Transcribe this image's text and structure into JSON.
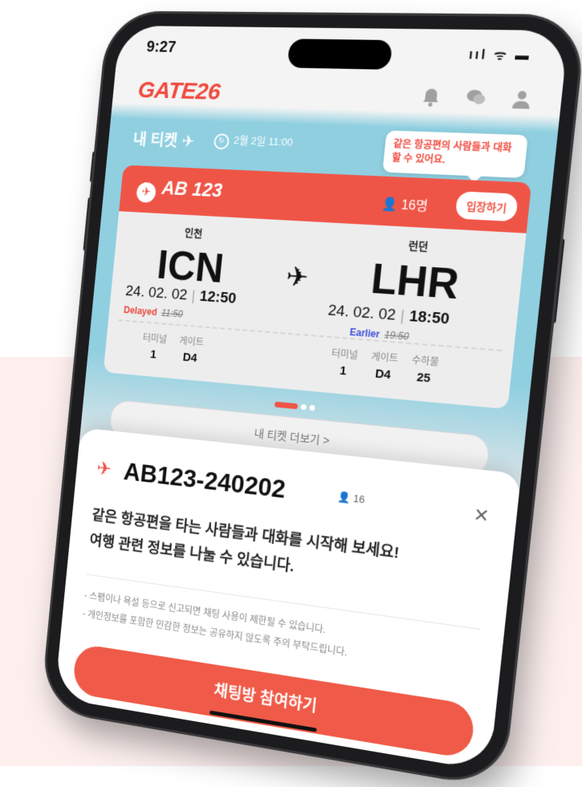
{
  "status_bar": {
    "time": "9:27",
    "icons": "ııl ᯤ ▬"
  },
  "header": {
    "logo": "GATE26"
  },
  "ticket_header": {
    "title": "내 티켓",
    "refresh_text": "2월 2일 11:00",
    "tooltip": "같은 항공편의 사람들과 대화할 수 있어요."
  },
  "flight_bar": {
    "code": "AB 123",
    "count": "16명",
    "enter_label": "입장하기"
  },
  "ticket": {
    "from": {
      "city": "인천",
      "iata": "ICN",
      "date": "24. 02. 02",
      "time": "12:50",
      "status": "Delayed",
      "old_time": "11:50"
    },
    "to": {
      "city": "런던",
      "iata": "LHR",
      "date": "24. 02. 02",
      "time": "18:50",
      "status": "Earlier",
      "old_time": "19:50"
    },
    "from_info": [
      {
        "label": "터미널",
        "value": "1"
      },
      {
        "label": "게이트",
        "value": "D4"
      }
    ],
    "to_info": [
      {
        "label": "터미널",
        "value": "1"
      },
      {
        "label": "게이트",
        "value": "D4"
      },
      {
        "label": "수하물",
        "value": "25"
      }
    ]
  },
  "more_button": "내 티켓 더보기 >",
  "sheet": {
    "title": "AB123-240202",
    "count": "16",
    "message_line1": "같은 항공편을 타는 사람들과 대화를 시작해 보세요!",
    "message_line2": "여행 관련 정보를 나눌 수 있습니다.",
    "note1": "- 스팸이나 욕설 등으로 신고되면 채팅 사용이 제한될 수 있습니다.",
    "note2": "- 개인정보를 포함한 민감한 정보는 공유하지 않도록 주의 부탁드립니다.",
    "join_label": "채팅방 참여하기"
  },
  "colors": {
    "brand": "#ef5547",
    "delayed": "#e8463b",
    "earlier": "#3b4fd8",
    "sky": "#8fcfe0"
  },
  "icons": [
    "bell-icon",
    "chat-icon",
    "user-icon",
    "plane-icon",
    "refresh-icon",
    "person-icon",
    "close-icon"
  ]
}
